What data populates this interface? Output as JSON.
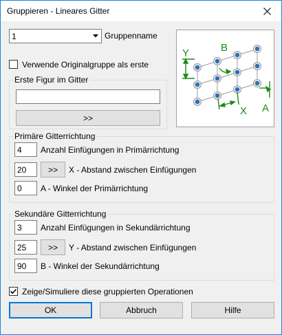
{
  "window": {
    "title": "Gruppieren - Lineares Gitter"
  },
  "group_select": {
    "value": "1",
    "label": "Gruppenname"
  },
  "use_original": {
    "label": "Verwende Originalgruppe als erste",
    "checked": false
  },
  "first_figure": {
    "title": "Erste Figur im Gitter",
    "value": "",
    "button": ">>"
  },
  "preview": {
    "labels": {
      "y": "Y",
      "b": "B",
      "x": "X",
      "a": "A"
    }
  },
  "primary": {
    "title": "Primäre Gitterrichtung",
    "count": {
      "value": "4",
      "label": "Anzahl Einfügungen in Primärrichtung"
    },
    "distance": {
      "value": "20",
      "button": ">>",
      "label": "X - Abstand zwischen Einfügungen"
    },
    "angle": {
      "value": "0",
      "label": "A - Winkel der Primärrichtung"
    }
  },
  "secondary": {
    "title": "Sekundäre Gitterrichtung",
    "count": {
      "value": "3",
      "label": "Anzahl Einfügungen in Sekundärrichtung"
    },
    "distance": {
      "value": "25",
      "button": ">>",
      "label": "Y - Abstand zwischen Einfügungen"
    },
    "angle": {
      "value": "90",
      "label": "B - Winkel der Sekundärrichtung"
    }
  },
  "show_simulate": {
    "label": "Zeige/Simuliere diese gruppierten Operationen",
    "checked": true
  },
  "buttons": {
    "ok": "OK",
    "cancel": "Abbruch",
    "help": "Hilfe"
  },
  "colors": {
    "accent": "#0078d7",
    "diagram_green": "#1a8a1a",
    "dot_blue": "#2a6fbf"
  }
}
